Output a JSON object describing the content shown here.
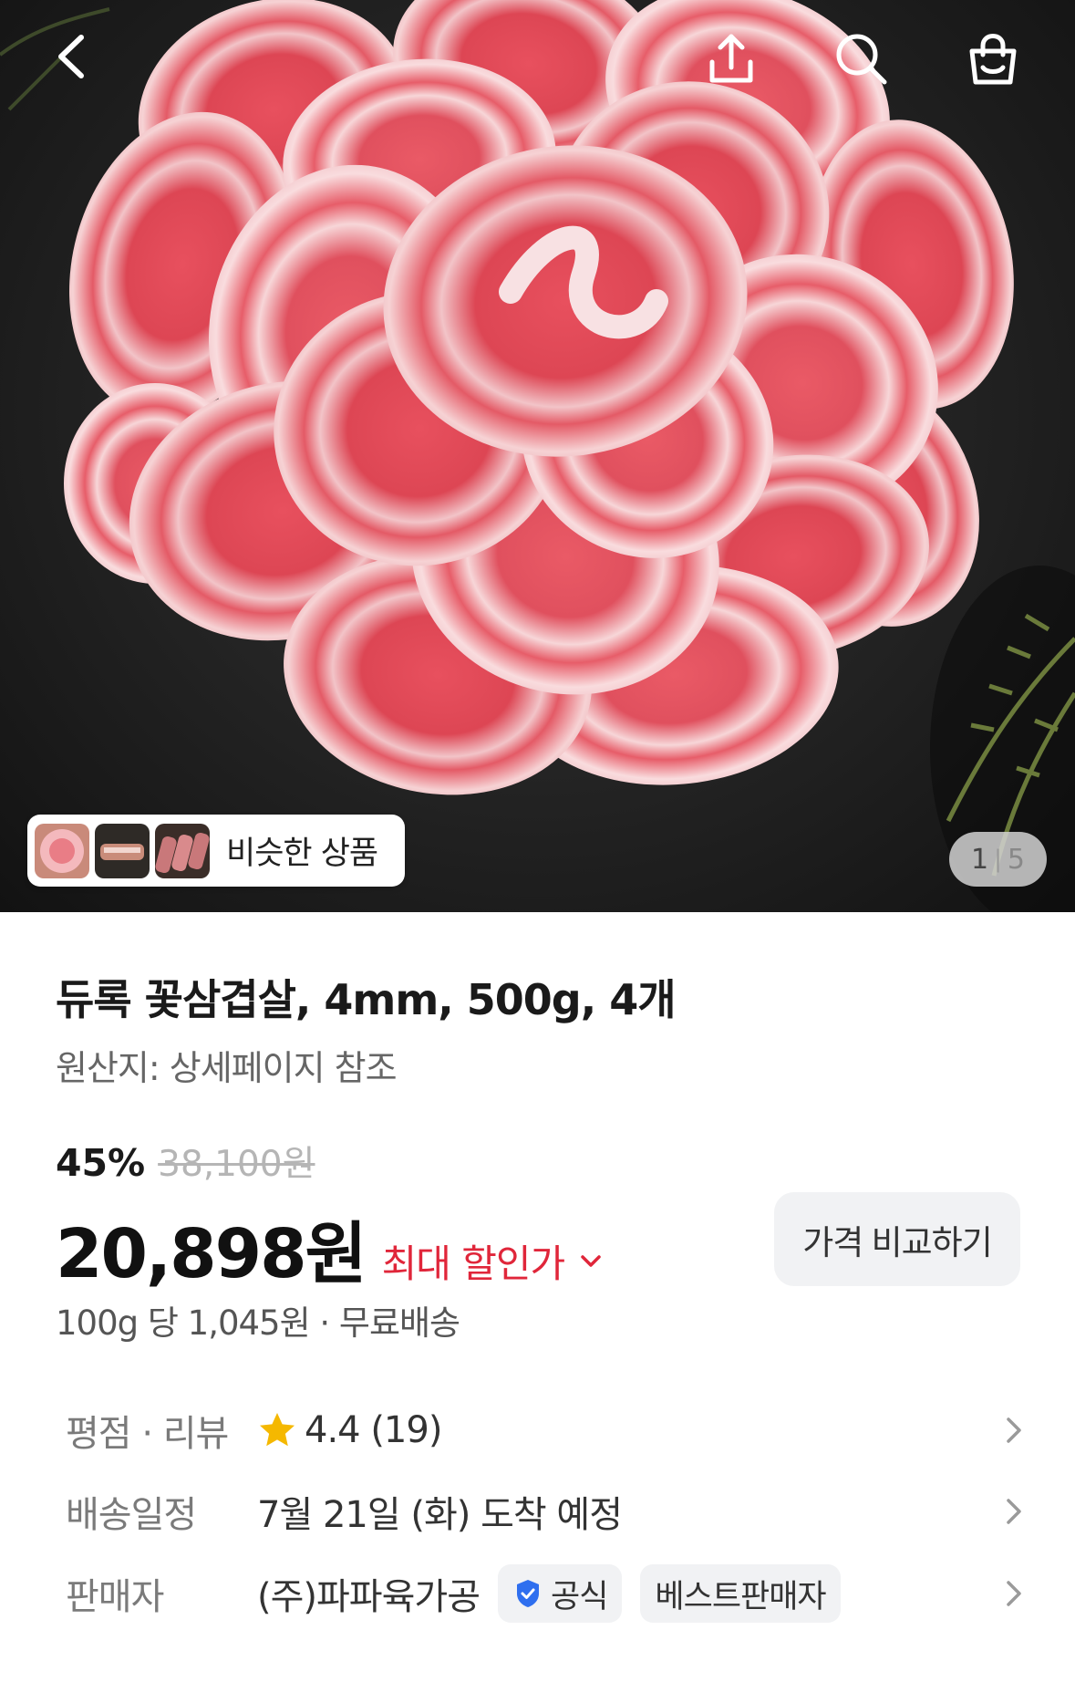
{
  "header": {
    "back_icon": "chevron-left-icon",
    "share_icon": "share-icon",
    "search_icon": "search-icon",
    "cart_icon": "shopping-bag-icon"
  },
  "gallery": {
    "similar_label": "비슷한 상품",
    "current_page": "1",
    "total_pages": "5"
  },
  "product": {
    "title": "듀록 꽃삼겹살, 4mm, 500g, 4개",
    "origin": "원산지: 상세페이지 참조",
    "discount_rate": "45%",
    "original_price": "38,100원",
    "price": "20,898원",
    "max_discount_label": "최대 할인가",
    "compare_button": "가격 비교하기",
    "unit_price": "100g 당 1,045원 · 무료배송"
  },
  "info": {
    "rating_label": "평점 · 리뷰",
    "rating_value": "4.4 (19)",
    "delivery_label": "배송일정",
    "delivery_value": "7월 21일 (화) 도착 예정",
    "seller_label": "판매자",
    "seller_value": "(주)파파육가공",
    "official_badge": "공식",
    "best_seller_badge": "베스트판매자"
  },
  "colors": {
    "accent_red": "#e0263a",
    "star_yellow": "#f5b800",
    "verified_blue": "#2f6fef",
    "text_dark": "#1a1a1a",
    "text_gray": "#7a7a7a"
  }
}
